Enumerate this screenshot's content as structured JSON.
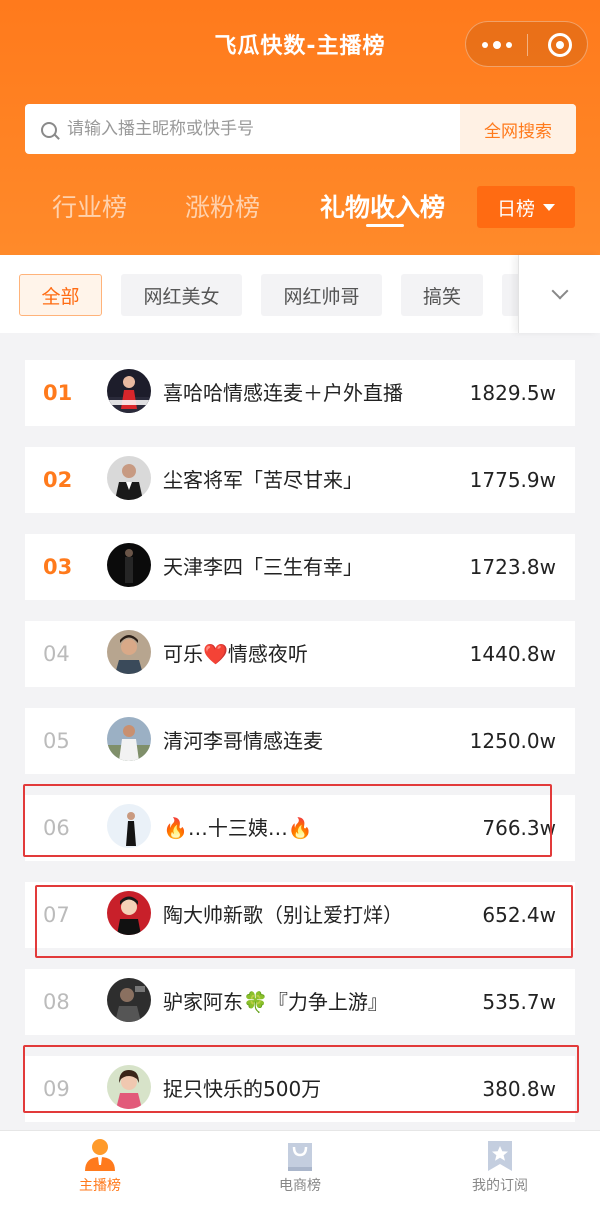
{
  "app": {
    "title": "飞瓜快数-主播榜"
  },
  "search": {
    "placeholder": "请输入播主昵称或快手号",
    "button": "全网搜索"
  },
  "tabs": [
    {
      "label": "行业榜"
    },
    {
      "label": "涨粉榜"
    },
    {
      "label": "礼物收入榜",
      "active": true
    }
  ],
  "period": {
    "label": "日榜"
  },
  "categories": [
    {
      "label": "全部",
      "active": true
    },
    {
      "label": "网红美女"
    },
    {
      "label": "网红帅哥"
    },
    {
      "label": "搞笑"
    }
  ],
  "ranking": [
    {
      "rank": "01",
      "name": "喜哈哈情感连麦＋户外直播",
      "value": "1829.5w"
    },
    {
      "rank": "02",
      "name": "尘客将军「苦尽甘来」",
      "value": "1775.9w"
    },
    {
      "rank": "03",
      "name": "天津李四「三生有幸」",
      "value": "1723.8w"
    },
    {
      "rank": "04",
      "name": "可乐❤️情感夜听",
      "value": "1440.8w"
    },
    {
      "rank": "05",
      "name": "清河李哥情感连麦",
      "value": "1250.0w"
    },
    {
      "rank": "06",
      "name": "🔥…十三姨…🔥",
      "value": "766.3w"
    },
    {
      "rank": "07",
      "name": "陶大帅新歌（别让爱打烊）",
      "value": "652.4w"
    },
    {
      "rank": "08",
      "name": "驴家阿东🍀『力争上游』",
      "value": "535.7w"
    },
    {
      "rank": "09",
      "name": "捉只快乐的500万",
      "value": "380.8w"
    }
  ],
  "bottom_nav": [
    {
      "label": "主播榜",
      "icon": "anchor-person-icon",
      "active": true
    },
    {
      "label": "电商榜",
      "icon": "shopping-bag-icon"
    },
    {
      "label": "我的订阅",
      "icon": "star-bookmark-icon"
    }
  ],
  "colors": {
    "brand": "#ff7a1c",
    "highlight": "#e23a3a"
  }
}
